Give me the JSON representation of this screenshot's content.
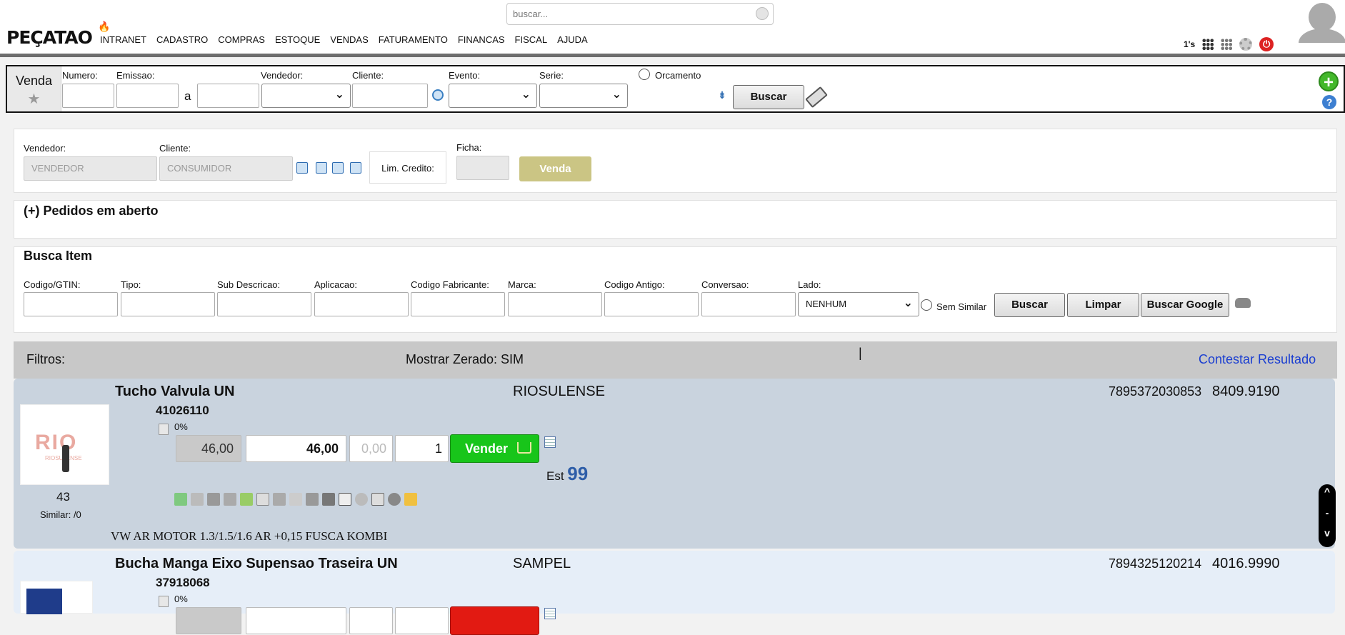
{
  "header": {
    "logo": "PEÇATAO",
    "menu": [
      "INTRANET",
      "CADASTRO",
      "COMPRAS",
      "ESTOQUE",
      "VENDAS",
      "FATURAMENTO",
      "FINANCAS",
      "FISCAL",
      "AJUDA"
    ],
    "search_placeholder": "buscar...",
    "ones_label": "1's"
  },
  "filter": {
    "title": "Venda",
    "labels": {
      "numero": "Numero:",
      "emissao": "Emissao:",
      "a": "a",
      "vendedor": "Vendedor:",
      "cliente": "Cliente:",
      "evento": "Evento:",
      "serie": "Serie:",
      "orcamento": "Orcamento"
    },
    "buscar": "Buscar"
  },
  "venda_panel": {
    "vendedor_label": "Vendedor:",
    "cliente_label": "Cliente:",
    "vendedor_value": "VENDEDOR",
    "cliente_value": "CONSUMIDOR",
    "lim_credito": "Lim. Credito:",
    "ficha_label": "Ficha:",
    "venda_button": "Venda"
  },
  "pedidos": {
    "title": "(+) Pedidos em aberto"
  },
  "busca_item": {
    "title": "Busca Item",
    "labels": [
      "Codigo/GTIN:",
      "Tipo:",
      "Sub Descricao:",
      "Aplicacao:",
      "Codigo Fabricante:",
      "Marca:",
      "Codigo Antigo:",
      "Conversao:",
      "Lado:"
    ],
    "lado_value": "NENHUM",
    "sem_similar": "Sem Similar",
    "buscar": "Buscar",
    "limpar": "Limpar",
    "buscar_google": "Buscar Google"
  },
  "results": {
    "filtros": "Filtros:",
    "mostrar_zerado": "Mostrar Zerado: SIM",
    "contestar": "Contestar Resultado",
    "items": [
      {
        "name": "Tucho Valvula UN",
        "code": "41026110",
        "brand": "RIOSULENSE",
        "gtin": "7895372030853",
        "ref": "8409.9190",
        "percent": "0%",
        "price_list": "46,00",
        "price": "46,00",
        "discount": "0,00",
        "qty": "1",
        "vender": "Vender",
        "est_label": "Est",
        "est_value": "99",
        "count": "43",
        "similar": "Similar: /0",
        "application": "VW AR MOTOR 1.3/1.5/1.6 AR +0,15 FUSCA KOMBI",
        "img_brand": "RIO",
        "img_brand_sub": "RIOSULENSE"
      },
      {
        "name": "Bucha Manga Eixo Supensao Traseira UN",
        "code": "37918068",
        "brand": "SAMPEL",
        "gtin": "7894325120214",
        "ref": "4016.9990",
        "percent": "0%"
      }
    ]
  },
  "side_control": {
    "up": "^",
    "mid": "-",
    "down": "v"
  },
  "colors": {
    "accent_green": "#18c51a",
    "accent_red": "#e21a12",
    "link_blue": "#1a3ed1",
    "venda_btn": "#cbc584",
    "row_bg": "#c9d3de"
  }
}
